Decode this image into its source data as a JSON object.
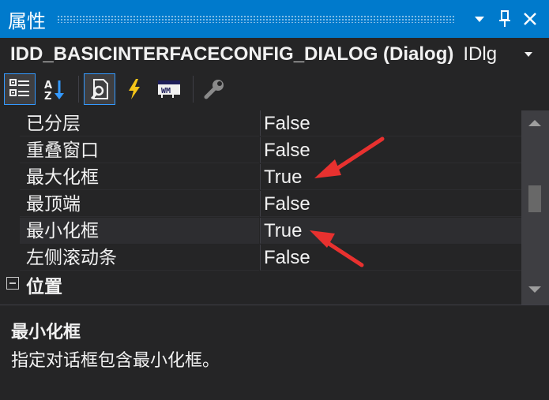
{
  "window": {
    "title": "属性"
  },
  "object_selector": {
    "name": "IDD_BASICINTERFACECONFIG_DIALOG (Dialog)",
    "type": "IDlg"
  },
  "toolbar": {
    "buttons": [
      "categorized-icon",
      "alphabetical-icon",
      "properties-icon",
      "events-icon",
      "messages-icon",
      "overrides-icon"
    ]
  },
  "properties": [
    {
      "name": "已分层",
      "value": "False"
    },
    {
      "name": "重叠窗口",
      "value": "False"
    },
    {
      "name": "最大化框",
      "value": "True"
    },
    {
      "name": "最顶端",
      "value": "False"
    },
    {
      "name": "最小化框",
      "value": "True"
    },
    {
      "name": "左侧滚动条",
      "value": "False"
    }
  ],
  "category": {
    "label": "位置"
  },
  "description": {
    "title": "最小化框",
    "text": "指定对话框包含最小化框。"
  },
  "colors": {
    "accent": "#007acc",
    "background": "#252526",
    "annotation_arrow": "#e8312f"
  }
}
